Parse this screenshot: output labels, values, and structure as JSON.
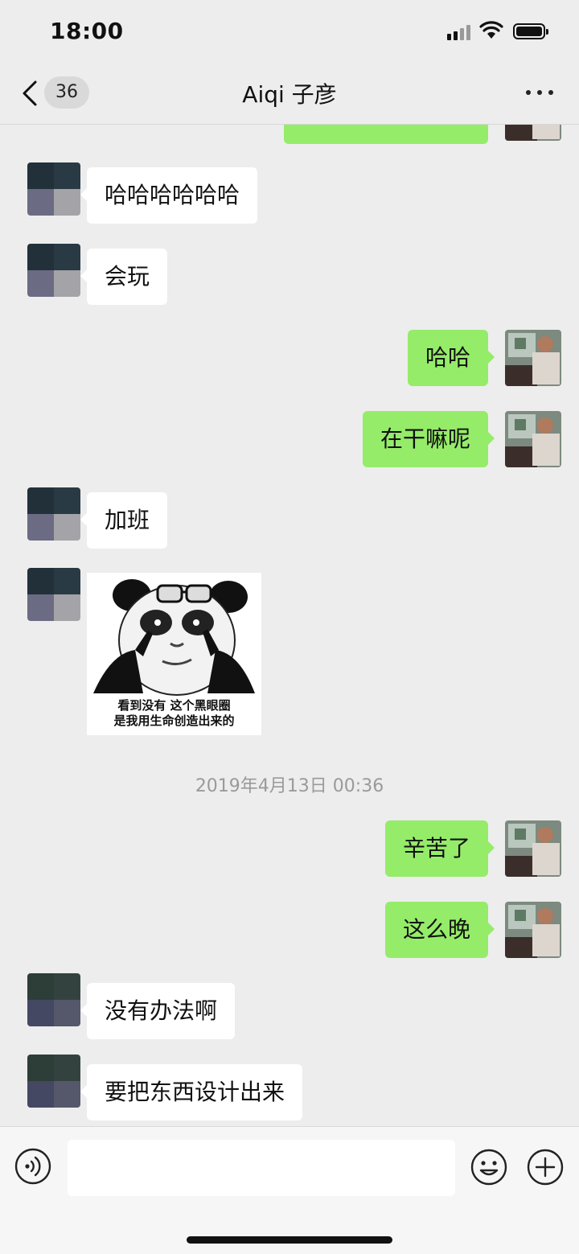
{
  "status": {
    "time": "18:00"
  },
  "nav": {
    "unread_count": "36",
    "title": "Aiqi 子彦"
  },
  "messages": {
    "m0": "",
    "m1": "哈哈哈哈哈哈",
    "m2": "会玩",
    "m3": "哈哈",
    "m4": "在干嘛呢",
    "m5": "加班",
    "sticker_caption_line1": "看到没有 这个黑眼圈",
    "sticker_caption_line2": "是我用生命创造出来的",
    "timestamp": "2019年4月13日 00:36",
    "m6": "辛苦了",
    "m7": "这么晚",
    "m8": "没有办法啊",
    "m9": "要把东西设计出来"
  },
  "input": {
    "placeholder": ""
  },
  "colors": {
    "outgoing_bubble": "#95ec69",
    "incoming_bubble": "#ffffff",
    "background": "#ededed"
  }
}
